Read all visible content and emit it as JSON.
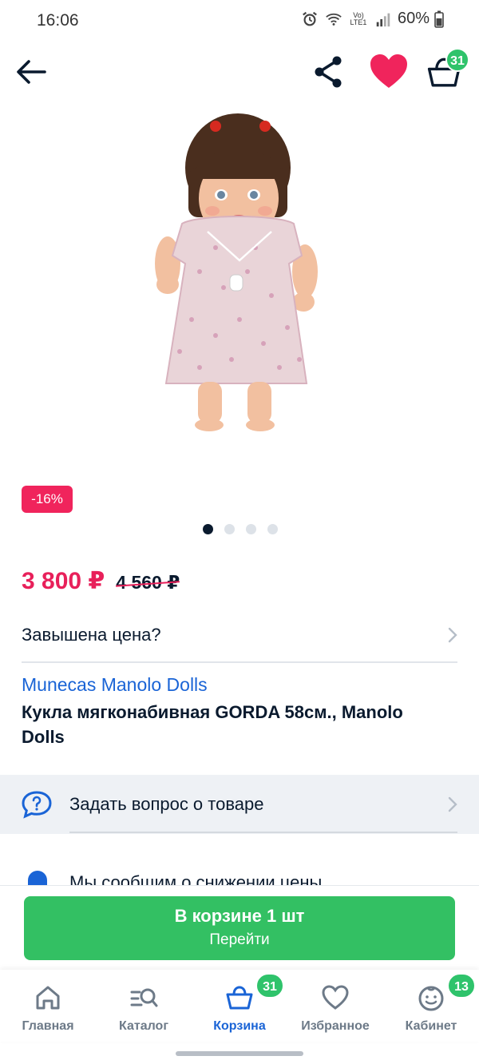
{
  "status": {
    "time": "16:06",
    "battery": "60%",
    "network": "Vo) LTE1"
  },
  "header": {
    "cart_count": "31"
  },
  "product": {
    "discount": "-16%",
    "price": "3 800 ₽",
    "old_price": "4 560 ₽",
    "brand": "Munecas Manolo Dolls",
    "title": "Кукла  мягконабивная GORDA 58см., Manolo Dolls",
    "gallery_total": 4,
    "gallery_index": 1
  },
  "links": {
    "overprice": "Завышена цена?",
    "ask_question": "Задать вопрос о товаре",
    "notify": "Мы сообщим о снижении цены"
  },
  "cart_button": {
    "title": "В корзине 1 шт",
    "subtitle": "Перейти"
  },
  "tabs": [
    {
      "label": "Главная",
      "icon": "home-icon"
    },
    {
      "label": "Каталог",
      "icon": "catalog-search-icon"
    },
    {
      "label": "Корзина",
      "icon": "basket-icon",
      "badge": "31",
      "active": true
    },
    {
      "label": "Избранное",
      "icon": "heart-outline-icon"
    },
    {
      "label": "Кабинет",
      "icon": "profile-face-icon",
      "badge": "13"
    }
  ],
  "colors": {
    "accent_pink": "#e8205a",
    "brand_blue": "#1a64d6",
    "green": "#33c063",
    "badge_green": "#2fc36b"
  }
}
